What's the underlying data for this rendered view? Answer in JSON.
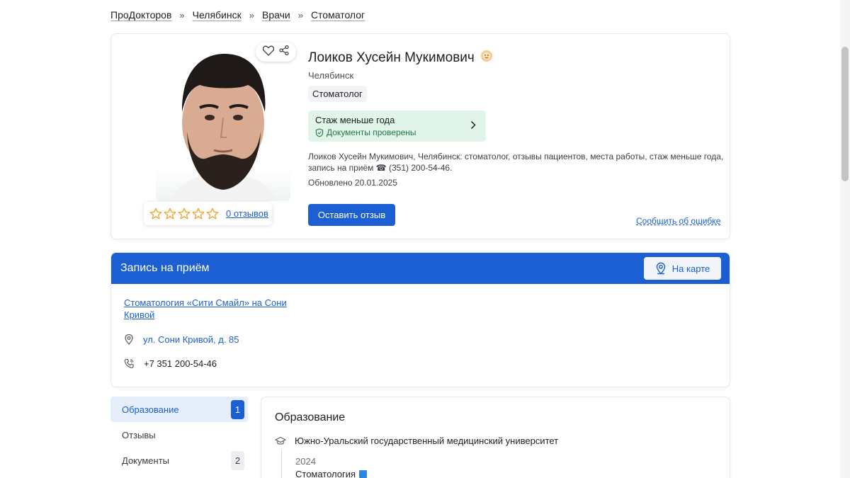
{
  "breadcrumbs": [
    "ПроДокторов",
    "Челябинск",
    "Врачи",
    "Стоматолог"
  ],
  "breadcrumb_separator": "»",
  "doctor": {
    "name": "Лоиков Хусейн Мукимович",
    "city": "Челябинск",
    "specialty": "Стоматолог",
    "experience_title": "Стаж меньше года",
    "verified_text": "Документы проверены",
    "description": "Лоиков Хусейн Мукимович, Челябинск: стоматолог, отзывы пациентов, места работы, стаж меньше года, запись на приём ☎ (351) 200-54-46.",
    "updated": "Обновлено 20.01.2025",
    "leave_review_label": "Оставить отзыв",
    "report_error_label": "Сообщить об ошибке",
    "reviews_link": "0 отзывов",
    "rating_stars_filled": 0,
    "rating_stars_total": 5
  },
  "appointment": {
    "title": "Запись на приём",
    "map_button": "На карте",
    "clinic_name": "Стоматология «Сити Смайл» на Сони Кривой",
    "address": "ул. Сони Кривой, д. 85",
    "phone": "+7 351 200-54-46"
  },
  "sidebar": {
    "items": [
      {
        "label": "Образование",
        "count": "1",
        "active": true
      },
      {
        "label": "Отзывы",
        "count": "",
        "active": false
      },
      {
        "label": "Документы",
        "count": "2",
        "active": false
      }
    ]
  },
  "education": {
    "title": "Образование",
    "university": "Южно-Уральский государственный медицинский университет",
    "year": "2024",
    "degree": "Стоматология"
  },
  "colors": {
    "accent": "#1c5fd2",
    "verified_bg": "#e1f4ea",
    "verified_text": "#1e7a47",
    "star": "#f2a533"
  },
  "icons": [
    "heart-icon",
    "share-icon",
    "star-icon",
    "shield-check-icon",
    "chevron-right-icon",
    "map-pin-icon",
    "location-icon",
    "phone-icon",
    "graduation-cap-icon",
    "book-icon",
    "emoji-badge-icon"
  ]
}
